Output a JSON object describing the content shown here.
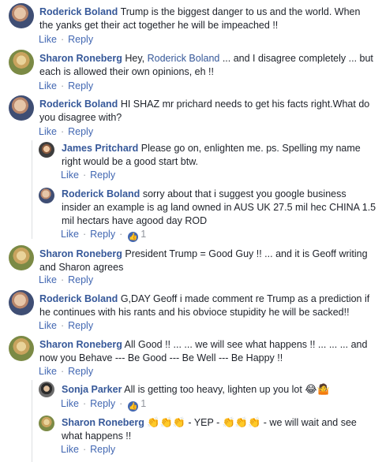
{
  "actions": {
    "like": "Like",
    "reply": "Reply",
    "separator": "·"
  },
  "comments": [
    {
      "name": "Roderick Boland",
      "text": "Trump is the biggest danger to us and the world. When the yanks get their act together he will be impeached !!"
    },
    {
      "name": "Sharon Roneberg",
      "text_before": "Hey,",
      "mention": "Roderick Boland",
      "text_after": "... and I disagree completely ... but each is allowed their own opinions, eh !!"
    },
    {
      "name": "Roderick Boland",
      "text": "HI SHAZ mr prichard needs to get his facts right.What do you disagree with?"
    },
    {
      "name": "James Pritchard",
      "text": "Please go on, enlighten me. ps. Spelling my name right would be a good start btw."
    },
    {
      "name": "Roderick Boland",
      "text": "sorry about that i suggest you google business insider an example is ag land owned in AUS UK 27.5 mil hec CHINA 1.5 mil hectars have agood day ROD",
      "likes": "1"
    },
    {
      "name": "Sharon Roneberg",
      "text": "President Trump = Good Guy !! ... and it is Geoff writing and Sharon agrees"
    },
    {
      "name": "Roderick Boland",
      "text": "G,DAY Geoff i made comment re Trump as a prediction if he continues with his rants and his obvioce stupidity he will be sacked!!"
    },
    {
      "name": "Sharon Roneberg",
      "text": "All Good !! ... ... we will see what happens !! ... ... ... and now you Behave --- Be Good --- Be Well --- Be Happy !!"
    },
    {
      "name": "Sonja Parker",
      "text": "All is getting too heavy, lighten up you lot",
      "emoji": "😂🤷",
      "likes": "1"
    },
    {
      "name": "Sharon Roneberg",
      "emoji_a": "👏👏👏",
      "text_mid": "- YEP -",
      "emoji_b": "👏👏👏",
      "text_end": "- we will wait and see what happens !!"
    }
  ]
}
